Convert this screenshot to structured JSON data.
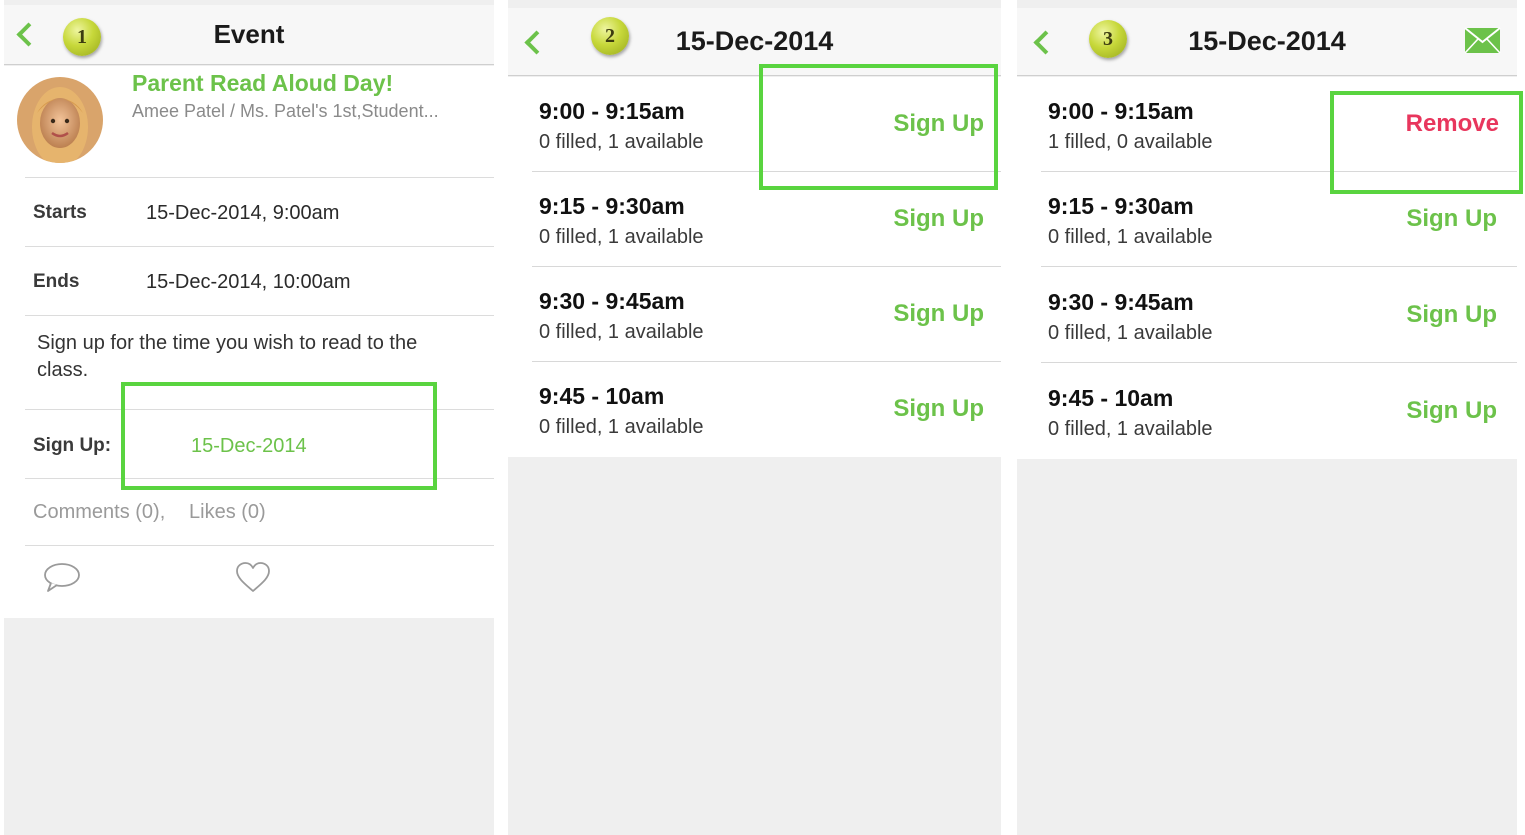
{
  "panel1": {
    "step": "1",
    "title": "Event",
    "event_title": "Parent Read Aloud Day!",
    "event_meta": "Amee Patel / Ms. Patel's 1st,Student...",
    "starts_label": "Starts",
    "starts_value": "15-Dec-2014, 9:00am",
    "ends_label": "Ends",
    "ends_value": "15-Dec-2014, 10:00am",
    "description": "Sign up for the time you wish to read to the class.",
    "signup_label": "Sign Up:",
    "signup_value": "15-Dec-2014",
    "comments": "Comments (0),",
    "likes": "Likes (0)",
    "icons": [
      "back-icon",
      "avatar",
      "comment-icon",
      "heart-icon"
    ]
  },
  "panel2": {
    "step": "2",
    "title": "15-Dec-2014",
    "slots": [
      {
        "time": "9:00 - 9:15am",
        "availability": "0 filled, 1 available",
        "action": "Sign Up"
      },
      {
        "time": "9:15 - 9:30am",
        "availability": "0 filled, 1 available",
        "action": "Sign Up"
      },
      {
        "time": "9:30 - 9:45am",
        "availability": "0 filled, 1 available",
        "action": "Sign Up"
      },
      {
        "time": "9:45 - 10am",
        "availability": "0 filled, 1 available",
        "action": "Sign Up"
      }
    ]
  },
  "panel3": {
    "step": "3",
    "title": "15-Dec-2014",
    "slots": [
      {
        "time": "9:00 - 9:15am",
        "availability": "1 filled, 0 available",
        "action": "Remove"
      },
      {
        "time": "9:15 - 9:30am",
        "availability": "0 filled, 1 available",
        "action": "Sign Up"
      },
      {
        "time": "9:30 - 9:45am",
        "availability": "0 filled, 1 available",
        "action": "Sign Up"
      },
      {
        "time": "9:45 - 10am",
        "availability": "0 filled, 1 available",
        "action": "Sign Up"
      }
    ],
    "icons": [
      "back-icon",
      "mail-icon"
    ]
  },
  "colors": {
    "accent_green": "#6cc24a",
    "highlight_green": "#59d43f",
    "remove_red": "#e8365d",
    "background_gray": "#efefef"
  }
}
